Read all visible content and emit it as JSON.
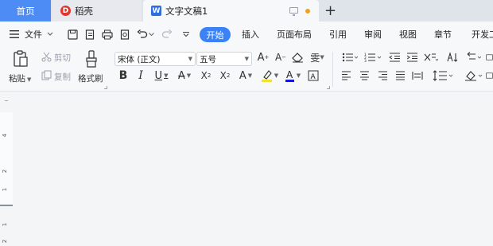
{
  "tabs": {
    "home": "首页",
    "daoke": "稻壳",
    "doc": "文字文稿1"
  },
  "menu": {
    "file": "文件",
    "items": [
      "开始",
      "插入",
      "页面布局",
      "引用",
      "审阅",
      "视图",
      "章节",
      "开发工"
    ]
  },
  "ribbon": {
    "paste": "粘贴",
    "cut": "剪切",
    "copy": "复制",
    "format_painter": "格式刷",
    "font_name": "宋体 (正文)",
    "font_size": "五号"
  },
  "ruler": {
    "numbers": [
      "4",
      "2",
      "1",
      "1",
      "2"
    ]
  },
  "colors": {
    "accent": "#3b82f6",
    "home_tab": "#4e8cf5",
    "highlight": "#f2e229",
    "font_color": "#1515d8"
  }
}
